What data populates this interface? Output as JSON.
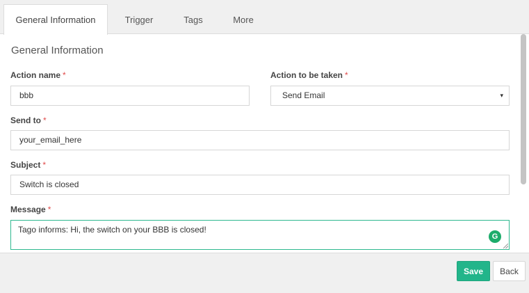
{
  "tabs": [
    {
      "label": "General Information"
    },
    {
      "label": "Trigger"
    },
    {
      "label": "Tags"
    },
    {
      "label": "More"
    }
  ],
  "form": {
    "section_title": "General Information",
    "action_name": {
      "label": "Action name",
      "required": "*",
      "value": "bbb"
    },
    "action_type": {
      "label": "Action to be taken",
      "required": "*",
      "value": "Send Email"
    },
    "send_to": {
      "label": "Send to",
      "required": "*",
      "value": "your_email_here"
    },
    "subject": {
      "label": "Subject",
      "required": "*",
      "value": "Switch is closed"
    },
    "message": {
      "label": "Message",
      "required": "*",
      "value": "Tago informs: Hi, the switch on your BBB is closed!"
    }
  },
  "footer": {
    "save_label": "Save",
    "back_label": "Back"
  },
  "icons": {
    "select_caret": "▾",
    "grammarly": "G"
  },
  "colors": {
    "accent": "#22b58a",
    "required": "#e04b4b",
    "textarea_border": "#2eb88f"
  }
}
